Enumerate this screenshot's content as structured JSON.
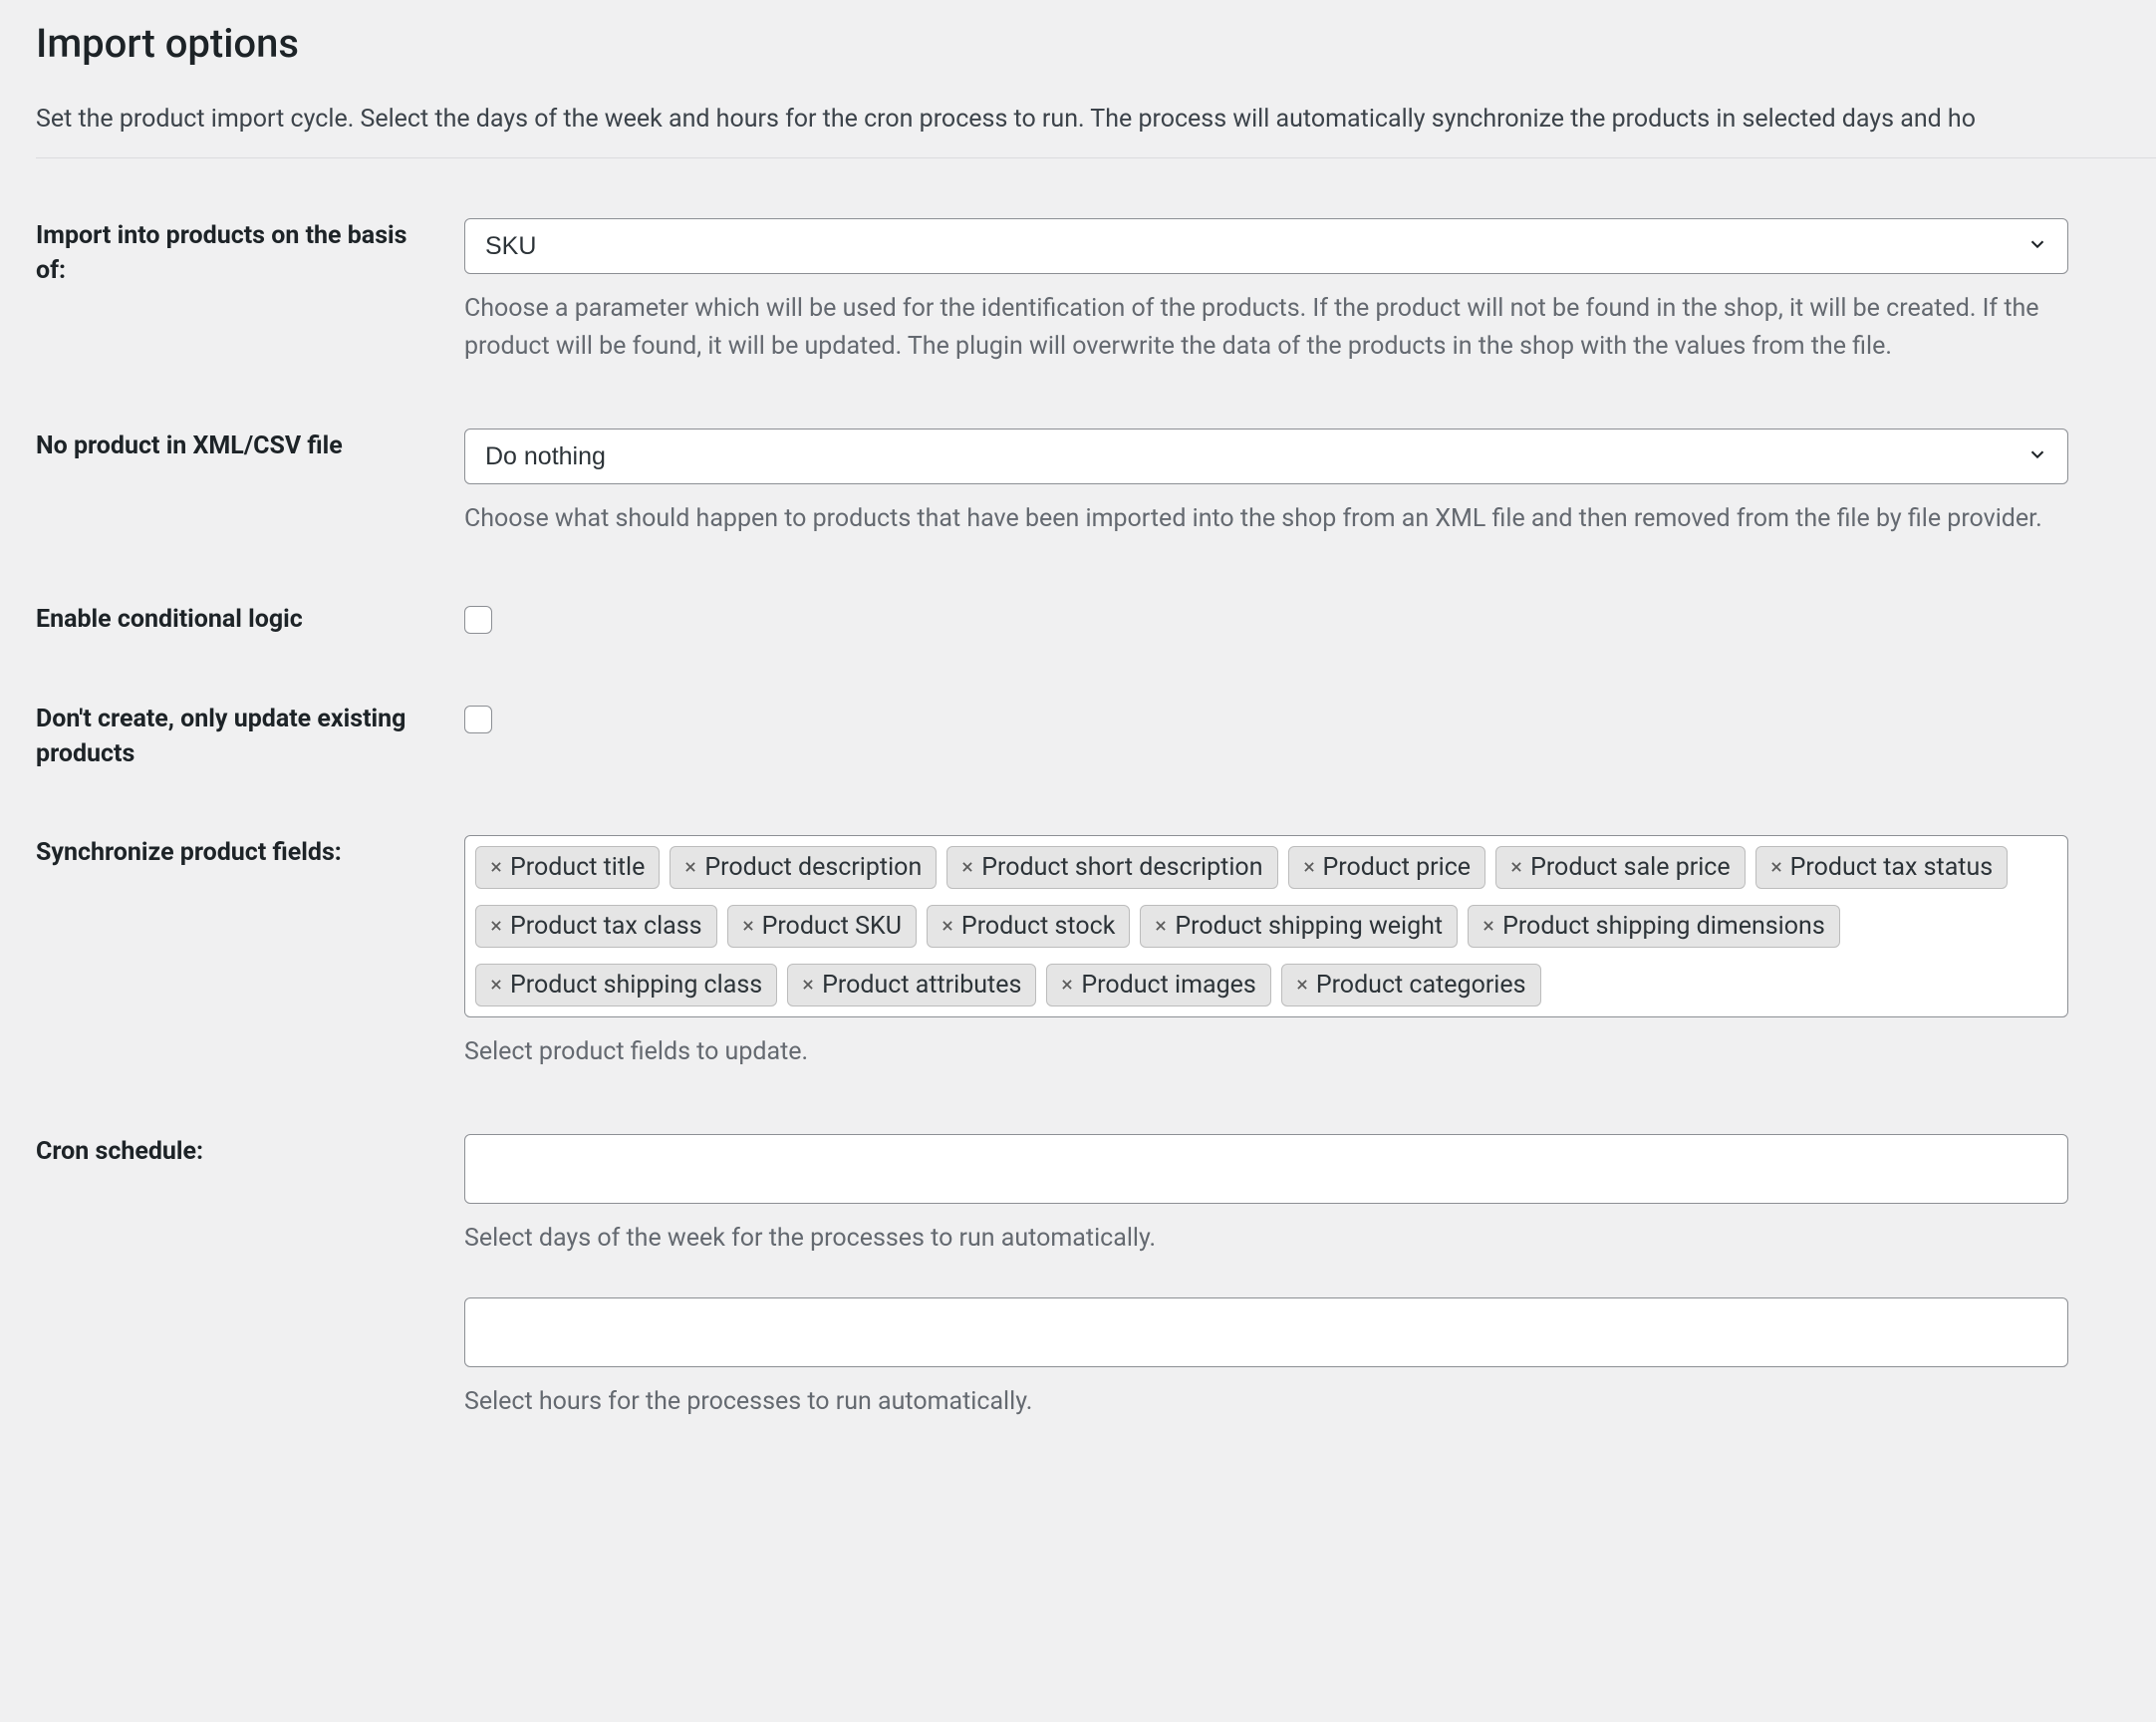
{
  "page": {
    "title": "Import options",
    "intro": "Set the product import cycle. Select the days of the week and hours for the cron process to run. The process will automatically synchronize the products in selected days and ho"
  },
  "fields": {
    "basis": {
      "label": "Import into products on the basis of:",
      "value": "SKU",
      "help": "Choose a parameter which will be used for the identification of the products. If the product will not be found in the shop, it will be created. If the product will be found, it will be updated. The plugin will overwrite the data of the products in the shop with the values from the file."
    },
    "no_product": {
      "label": "No product in XML/CSV file",
      "value": "Do nothing",
      "help": "Choose what should happen to products that have been imported into the shop from an XML file and then removed from the file by file provider."
    },
    "conditional": {
      "label": "Enable conditional logic"
    },
    "update_only": {
      "label": "Don't create, only update existing products"
    },
    "sync": {
      "label": "Synchronize product fields:",
      "help": "Select product fields to update.",
      "tags": [
        "Product title",
        "Product description",
        "Product short description",
        "Product price",
        "Product sale price",
        "Product tax status",
        "Product tax class",
        "Product SKU",
        "Product stock",
        "Product shipping weight",
        "Product shipping dimensions",
        "Product shipping class",
        "Product attributes",
        "Product images",
        "Product categories"
      ]
    },
    "cron": {
      "label": "Cron schedule:",
      "days_value": "",
      "days_help": "Select days of the week for the processes to run automatically.",
      "hours_value": "",
      "hours_help": "Select hours for the processes to run automatically."
    }
  }
}
